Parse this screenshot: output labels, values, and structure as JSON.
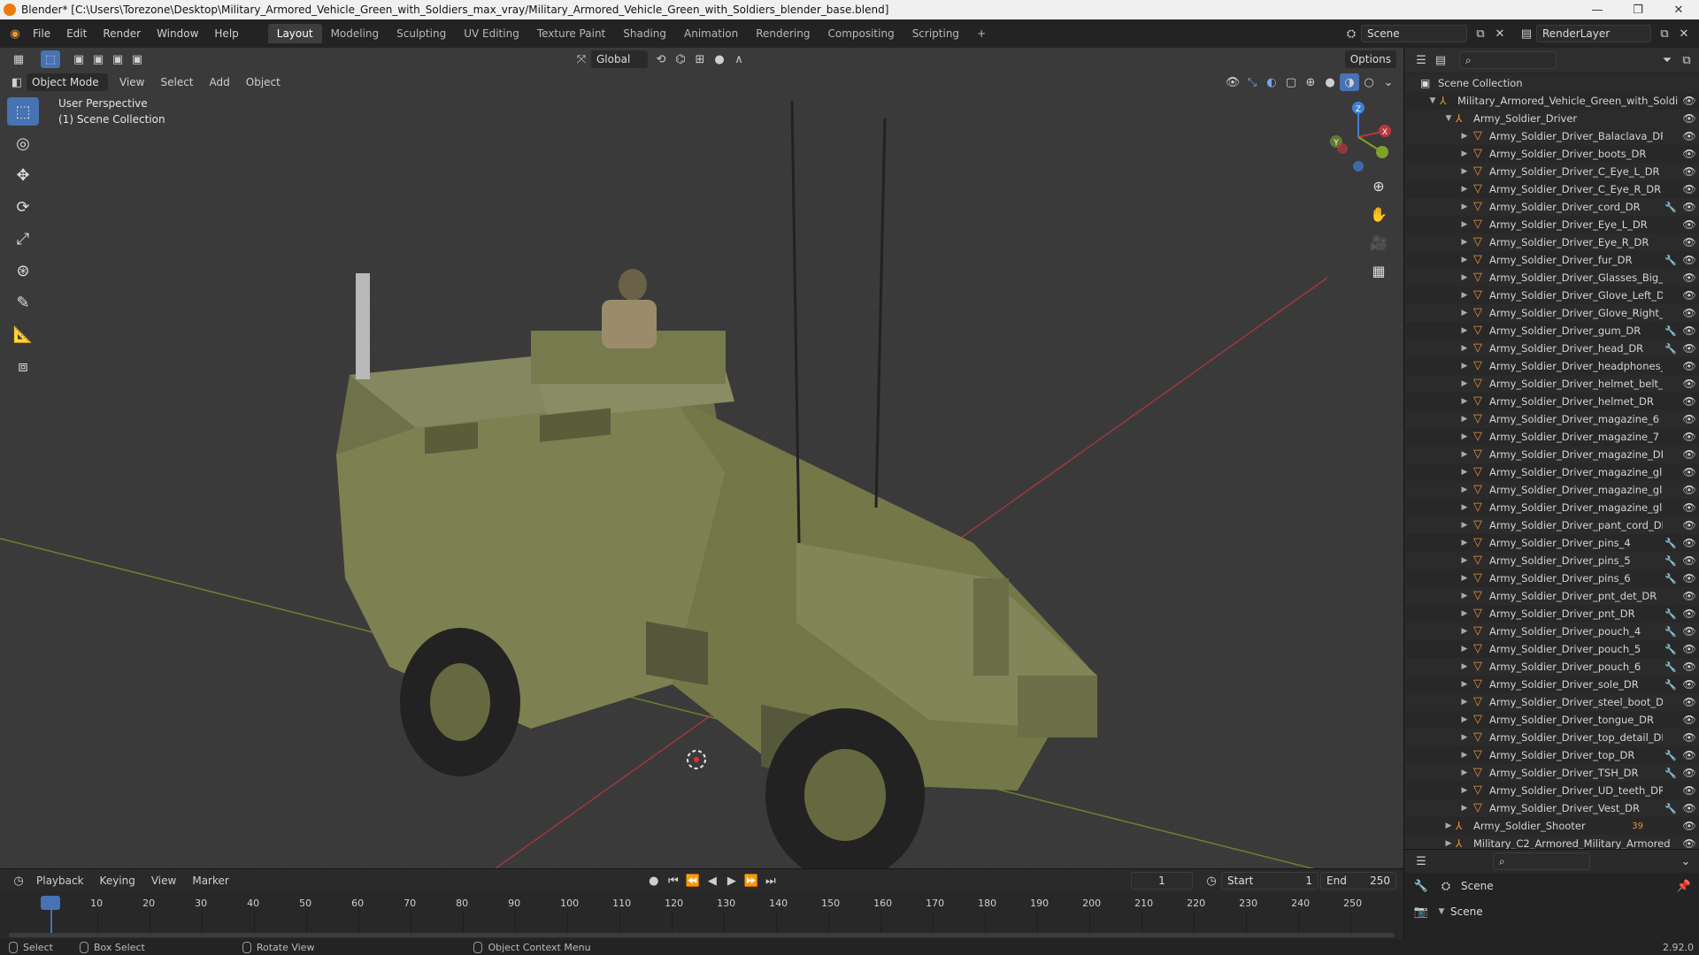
{
  "window": {
    "title": "Blender* [C:\\Users\\Torezone\\Desktop\\Military_Armored_Vehicle_Green_with_Soldiers_max_vray/Military_Armored_Vehicle_Green_with_Soldiers_blender_base.blend]",
    "minimize": "—",
    "maximize": "❐",
    "close": "✕"
  },
  "menu": [
    "File",
    "Edit",
    "Render",
    "Window",
    "Help"
  ],
  "workspaces": [
    {
      "label": "Layout",
      "active": true
    },
    {
      "label": "Modeling"
    },
    {
      "label": "Sculpting"
    },
    {
      "label": "UV Editing"
    },
    {
      "label": "Texture Paint"
    },
    {
      "label": "Shading"
    },
    {
      "label": "Animation"
    },
    {
      "label": "Rendering"
    },
    {
      "label": "Compositing"
    },
    {
      "label": "Scripting"
    }
  ],
  "add_workspace": "+",
  "scene": {
    "name": "Scene",
    "render_layer": "RenderLayer"
  },
  "viewport": {
    "mode": "Object Mode",
    "menus": [
      "View",
      "Select",
      "Add",
      "Object"
    ],
    "transform_orientation": "Global",
    "options": "Options",
    "perspective_label": "User Perspective",
    "collection_label": "(1) Scene Collection",
    "gizmo": {
      "x": "X",
      "y": "Y",
      "z": "Z"
    }
  },
  "outliner": {
    "root": "Scene Collection",
    "collection": "Military_Armored_Vehicle_Green_with_Soldi",
    "group": "Army_Soldier_Driver",
    "items": [
      {
        "name": "Army_Soldier_Driver_Balaclava_DR",
        "mod": false
      },
      {
        "name": "Army_Soldier_Driver_boots_DR",
        "mod": false
      },
      {
        "name": "Army_Soldier_Driver_C_Eye_L_DR",
        "mod": false
      },
      {
        "name": "Army_Soldier_Driver_C_Eye_R_DR",
        "mod": false
      },
      {
        "name": "Army_Soldier_Driver_cord_DR",
        "mod": true
      },
      {
        "name": "Army_Soldier_Driver_Eye_L_DR",
        "mod": false
      },
      {
        "name": "Army_Soldier_Driver_Eye_R_DR",
        "mod": false
      },
      {
        "name": "Army_Soldier_Driver_fur_DR",
        "mod": true
      },
      {
        "name": "Army_Soldier_Driver_Glasses_Big_D",
        "mod": false
      },
      {
        "name": "Army_Soldier_Driver_Glove_Left_DR",
        "mod": false
      },
      {
        "name": "Army_Soldier_Driver_Glove_Right_D",
        "mod": false
      },
      {
        "name": "Army_Soldier_Driver_gum_DR",
        "mod": true
      },
      {
        "name": "Army_Soldier_Driver_head_DR",
        "mod": true
      },
      {
        "name": "Army_Soldier_Driver_headphones_D",
        "mod": false
      },
      {
        "name": "Army_Soldier_Driver_helmet_belt_D",
        "mod": false
      },
      {
        "name": "Army_Soldier_Driver_helmet_DR",
        "mod": false
      },
      {
        "name": "Army_Soldier_Driver_magazine_6",
        "mod": false
      },
      {
        "name": "Army_Soldier_Driver_magazine_7",
        "mod": false
      },
      {
        "name": "Army_Soldier_Driver_magazine_DR",
        "mod": false
      },
      {
        "name": "Army_Soldier_Driver_magazine_glas",
        "mod": false
      },
      {
        "name": "Army_Soldier_Driver_magazine_glas",
        "mod": false
      },
      {
        "name": "Army_Soldier_Driver_magazine_glas",
        "mod": false
      },
      {
        "name": "Army_Soldier_Driver_pant_cord_DR",
        "mod": false
      },
      {
        "name": "Army_Soldier_Driver_pins_4",
        "mod": true
      },
      {
        "name": "Army_Soldier_Driver_pins_5",
        "mod": true
      },
      {
        "name": "Army_Soldier_Driver_pins_6",
        "mod": true
      },
      {
        "name": "Army_Soldier_Driver_pnt_det_DR",
        "mod": false
      },
      {
        "name": "Army_Soldier_Driver_pnt_DR",
        "mod": true
      },
      {
        "name": "Army_Soldier_Driver_pouch_4",
        "mod": true
      },
      {
        "name": "Army_Soldier_Driver_pouch_5",
        "mod": true
      },
      {
        "name": "Army_Soldier_Driver_pouch_6",
        "mod": true
      },
      {
        "name": "Army_Soldier_Driver_sole_DR",
        "mod": true
      },
      {
        "name": "Army_Soldier_Driver_steel_boot_DR",
        "mod": false
      },
      {
        "name": "Army_Soldier_Driver_tongue_DR",
        "mod": false
      },
      {
        "name": "Army_Soldier_Driver_top_detail_DR",
        "mod": false
      },
      {
        "name": "Army_Soldier_Driver_top_DR",
        "mod": true
      },
      {
        "name": "Army_Soldier_Driver_TSH_DR",
        "mod": true
      },
      {
        "name": "Army_Soldier_Driver_UD_teeth_DR",
        "mod": false
      },
      {
        "name": "Army_Soldier_Driver_Vest_DR",
        "mod": true
      }
    ],
    "extra_groups": [
      {
        "name": "Army_Soldier_Shooter",
        "badge": "39"
      },
      {
        "name": "Military_C2_Armored_Military_Armored"
      }
    ]
  },
  "properties": {
    "scene_label": "Scene",
    "scene_sub": "Scene"
  },
  "timeline": {
    "menus": [
      "Playback",
      "Keying",
      "View",
      "Marker"
    ],
    "current_frame": "1",
    "start_label": "Start",
    "start": "1",
    "end_label": "End",
    "end": "250",
    "ticks": [
      "1",
      "10",
      "20",
      "30",
      "40",
      "50",
      "60",
      "70",
      "80",
      "90",
      "100",
      "110",
      "120",
      "130",
      "140",
      "150",
      "160",
      "170",
      "180",
      "190",
      "200",
      "210",
      "220",
      "230",
      "240",
      "250"
    ]
  },
  "status": {
    "select": "Select",
    "box_select": "Box Select",
    "rotate_view": "Rotate View",
    "context_menu": "Object Context Menu",
    "version": "2.92.0"
  },
  "colors": {
    "accent": "#4772b3",
    "mesh_icon": "#e8943a",
    "vehicle": "#7d8050",
    "x_axis": "#b8383f",
    "y_axis": "#7ea329",
    "z_axis": "#3f80d6"
  }
}
